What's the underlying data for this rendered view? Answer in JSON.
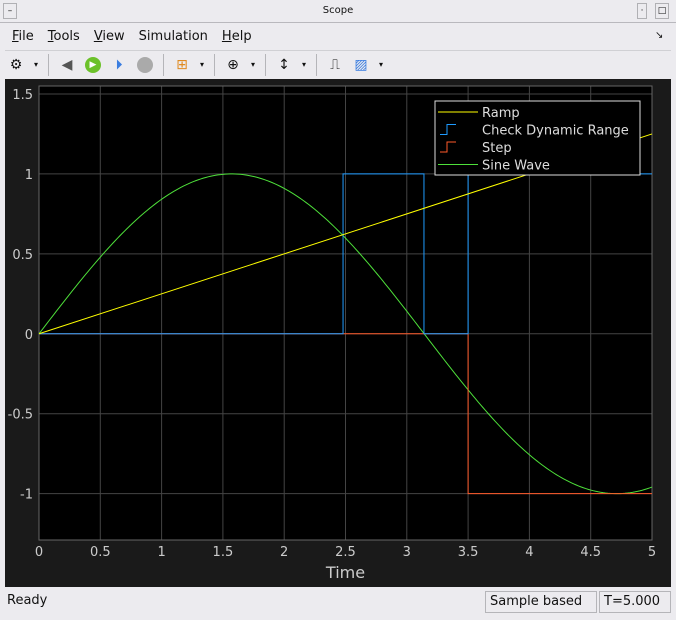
{
  "window": {
    "title": "Scope"
  },
  "menu": [
    {
      "label": "File",
      "u": "F",
      "rest": "ile"
    },
    {
      "label": "Tools",
      "u": "T",
      "rest": "ools"
    },
    {
      "label": "View",
      "u": "V",
      "rest": "iew"
    },
    {
      "label": "Simulation",
      "u": "S",
      "pre": "",
      "mid": "i",
      "rest": "mulation"
    },
    {
      "label": "Help",
      "u": "H",
      "rest": "elp"
    }
  ],
  "toolbar": [
    "gear-icon",
    "step-back-icon",
    "run-icon",
    "step-forward-icon",
    "stop-icon",
    "highlight-block-icon",
    "zoom-in-icon",
    "scale-axes-icon",
    "signal-icon",
    "ruler-icon"
  ],
  "status": {
    "text": "Ready",
    "mode": "Sample based",
    "time": "T=5.000"
  },
  "chart_data": {
    "type": "line",
    "xlabel": "Time",
    "ylabel": "",
    "xlim": [
      0,
      5
    ],
    "ylim": [
      -1.29,
      1.55
    ],
    "xticks": [
      "0",
      "0.5",
      "1",
      "1.5",
      "2",
      "2.5",
      "3",
      "3.5",
      "4",
      "4.5",
      "5"
    ],
    "yticks": [
      "1.5",
      "1",
      "0.5",
      "0",
      "-0.5",
      "-1"
    ],
    "grid": true,
    "legend_position": "top-right",
    "series": [
      {
        "name": "Ramp",
        "color": "#ffff00",
        "style": "line",
        "function": "0.25*t",
        "points": [
          [
            0,
            0
          ],
          [
            5,
            1.25
          ]
        ]
      },
      {
        "name": "Check  Dynamic Range",
        "color": "#1e9bff",
        "style": "stairs",
        "points": [
          [
            0,
            0
          ],
          [
            2.48,
            0
          ],
          [
            2.48,
            1
          ],
          [
            3.14,
            1
          ],
          [
            3.14,
            0
          ],
          [
            3.5,
            0
          ],
          [
            3.5,
            1
          ],
          [
            5,
            1
          ]
        ]
      },
      {
        "name": "Step",
        "color": "#ff5a2a",
        "style": "stairs",
        "points": [
          [
            0,
            0
          ],
          [
            3.5,
            0
          ],
          [
            3.5,
            -1
          ],
          [
            5,
            -1
          ]
        ]
      },
      {
        "name": "Sine Wave",
        "color": "#4ee03a",
        "style": "line",
        "function": "sin(t)"
      }
    ]
  }
}
